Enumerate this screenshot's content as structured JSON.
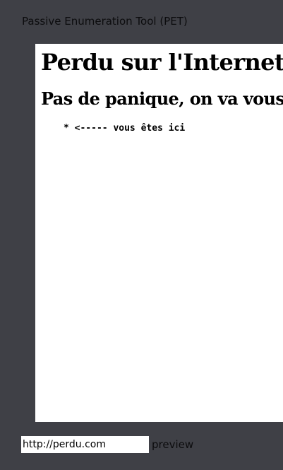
{
  "app": {
    "title": "Passive Enumeration Tool (PET)"
  },
  "preview": {
    "heading": "Perdu sur l'Internet ?",
    "subheading": "Pas de panique, on va vous aider",
    "list_text": "* <----- vous êtes ici"
  },
  "url_bar": {
    "value": "http://perdu.com",
    "button_label": "preview"
  }
}
